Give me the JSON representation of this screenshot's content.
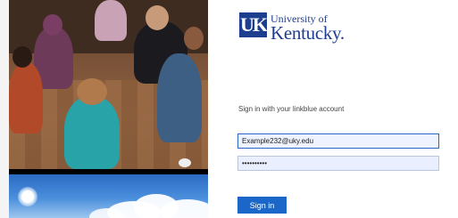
{
  "branding": {
    "logo_mark": "UK",
    "name_line1": "University of",
    "name_line2": "Kentucky.",
    "brand_color": "#1d3e8f"
  },
  "signin": {
    "prompt": "Sign in with your linkblue account",
    "username_value": "Example232@uky.edu",
    "password_value": "••••••••••",
    "button_label": "Sign in",
    "button_color": "#1a66c9"
  },
  "side_images": {
    "top": "classroom-photo",
    "bottom": "sky-photo"
  }
}
